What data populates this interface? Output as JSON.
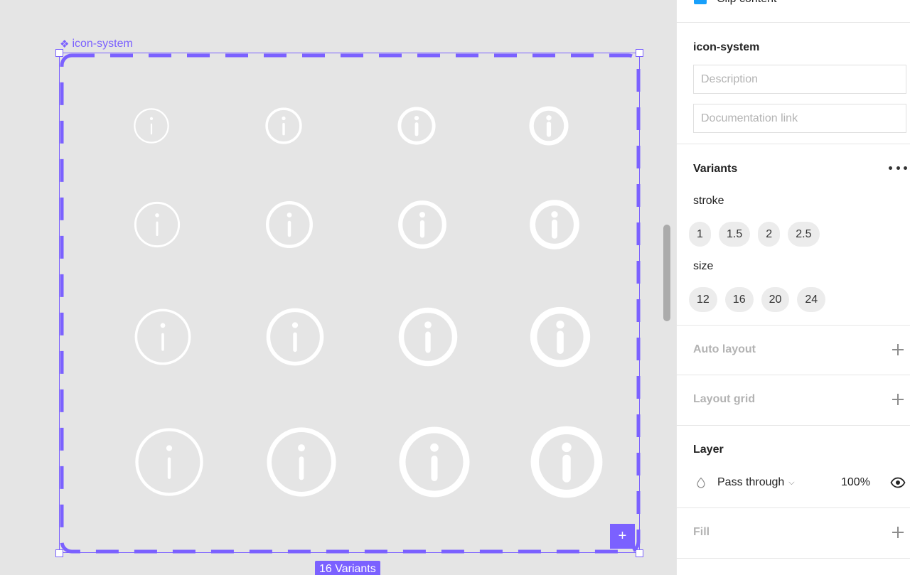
{
  "canvas": {
    "frame_name": "icon-system",
    "variant_count_label": "16 Variants",
    "accent_color": "#7b61ff",
    "icon_name": "info-circle-icon",
    "icon_color": "#ffffff",
    "variant_grid": [
      {
        "stroke": "1",
        "size": "12"
      },
      {
        "stroke": "1.5",
        "size": "12"
      },
      {
        "stroke": "2",
        "size": "12"
      },
      {
        "stroke": "2.5",
        "size": "12"
      },
      {
        "stroke": "1",
        "size": "16"
      },
      {
        "stroke": "1.5",
        "size": "16"
      },
      {
        "stroke": "2",
        "size": "16"
      },
      {
        "stroke": "2.5",
        "size": "16"
      },
      {
        "stroke": "1",
        "size": "20"
      },
      {
        "stroke": "1.5",
        "size": "20"
      },
      {
        "stroke": "2",
        "size": "20"
      },
      {
        "stroke": "2.5",
        "size": "20"
      },
      {
        "stroke": "1",
        "size": "24"
      },
      {
        "stroke": "1.5",
        "size": "24"
      },
      {
        "stroke": "2",
        "size": "24"
      },
      {
        "stroke": "2.5",
        "size": "24"
      }
    ]
  },
  "panel": {
    "clip_content_label": "Clip content",
    "component": {
      "name": "icon-system",
      "description_placeholder": "Description",
      "documentation_placeholder": "Documentation link"
    },
    "variants": {
      "title": "Variants",
      "properties": [
        {
          "name": "stroke",
          "values": [
            "1",
            "1.5",
            "2",
            "2.5"
          ]
        },
        {
          "name": "size",
          "values": [
            "12",
            "16",
            "20",
            "24"
          ]
        }
      ]
    },
    "auto_layout_title": "Auto layout",
    "layout_grid_title": "Layout grid",
    "layer": {
      "title": "Layer",
      "blend_mode": "Pass through",
      "opacity": "100%"
    },
    "fill_title": "Fill"
  }
}
